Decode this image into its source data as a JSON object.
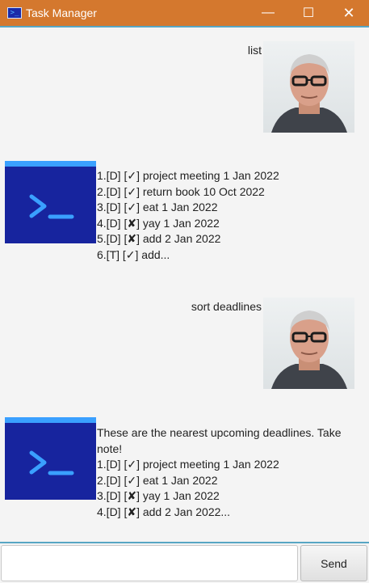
{
  "window": {
    "title": "Task Manager",
    "app_icon_glyph": ">_",
    "minimize_glyph": "—",
    "maximize_glyph": "☐",
    "close_glyph": "✕"
  },
  "messages": [
    {
      "sender": "user",
      "text": "list"
    },
    {
      "sender": "bot",
      "lines": [
        "1.[D] [✓] project meeting 1 Jan 2022",
        "2.[D] [✓] return book 10 Oct 2022",
        "3.[D] [✓] eat 1 Jan 2022",
        "4.[D] [✘] yay 1 Jan 2022",
        "5.[D] [✘] add 2 Jan 2022",
        "6.[T] [✓] add..."
      ]
    },
    {
      "sender": "user",
      "text": "sort deadlines"
    },
    {
      "sender": "bot",
      "intro": "These are the nearest upcoming deadlines. Take note!",
      "lines": [
        "1.[D] [✓] project meeting 1 Jan 2022",
        "2.[D] [✓] eat 1 Jan 2022",
        "3.[D] [✘] yay 1 Jan 2022",
        "4.[D] [✘] add 2 Jan 2022..."
      ]
    }
  ],
  "input": {
    "value": "",
    "placeholder": ""
  },
  "send_label": "Send",
  "colors": {
    "titlebar": "#d4782e",
    "accent_line": "#58a6c4",
    "bot_avatar_bg": "#17249e",
    "bot_avatar_glyph": "#3aa0ff"
  },
  "icons": {
    "user_avatar": "user-avatar-photo",
    "bot_avatar": "terminal-icon"
  }
}
